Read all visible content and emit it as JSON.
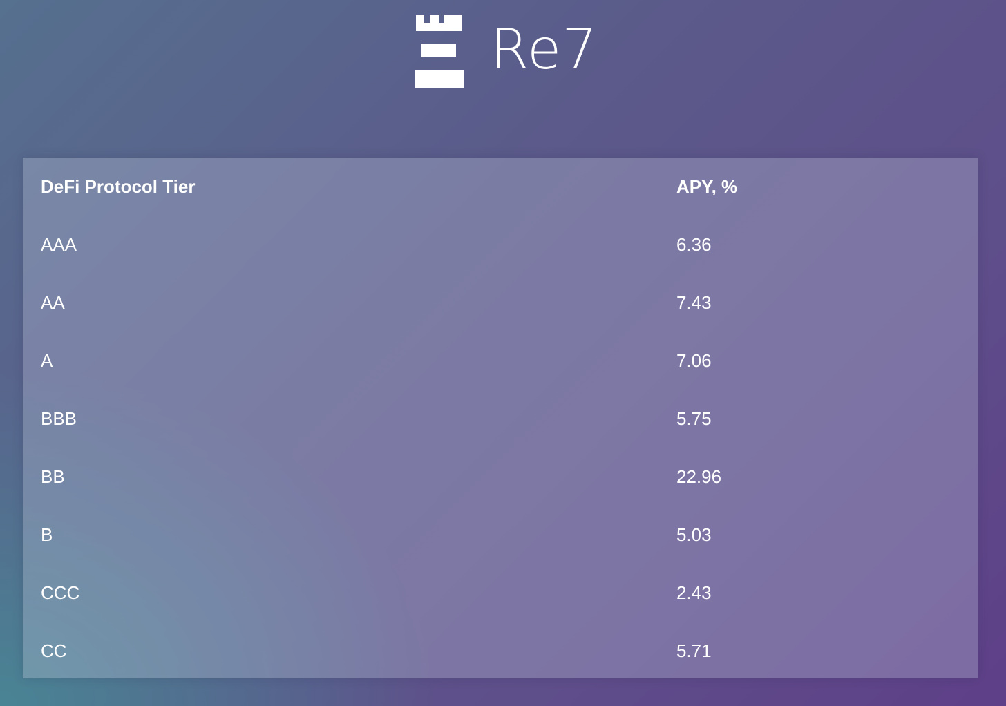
{
  "header": {
    "logo_icon": "rook-tower-icon",
    "brand_name": "Re7"
  },
  "table": {
    "columns": [
      "DeFi Protocol Tier",
      "APY, %"
    ],
    "rows": [
      {
        "tier": "AAA",
        "apy": "6.36"
      },
      {
        "tier": "AA",
        "apy": "7.43"
      },
      {
        "tier": "A",
        "apy": "7.06"
      },
      {
        "tier": "BBB",
        "apy": "5.75"
      },
      {
        "tier": "BB",
        "apy": "22.96"
      },
      {
        "tier": "B",
        "apy": "5.03"
      },
      {
        "tier": "CCC",
        "apy": "2.43"
      },
      {
        "tier": "CC",
        "apy": "5.71"
      }
    ]
  },
  "colors": {
    "background_start": "#56708f",
    "background_end": "#5e3f88",
    "background_teal": "#468c96",
    "text": "#ffffff"
  }
}
